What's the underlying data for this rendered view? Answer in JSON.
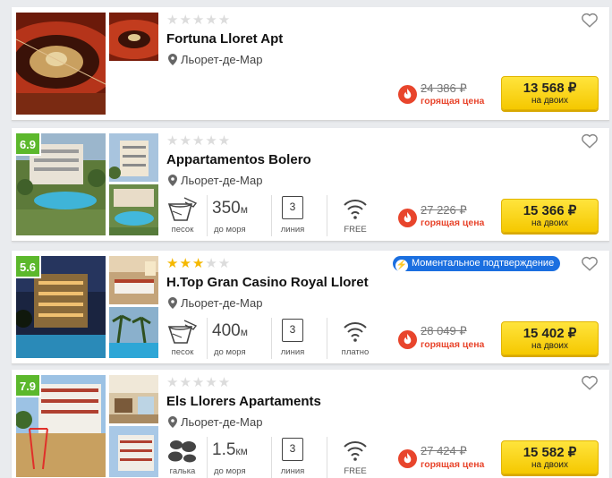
{
  "colors": {
    "rating_bg": "#5cb82c",
    "star_on": "#f5b800",
    "price_button": "#f5c800",
    "hot": "#e8452c",
    "instant_badge": "#1b6fe0"
  },
  "hotels": [
    {
      "name": "Fortuna Lloret Apt",
      "location": "Льорет-де-Мар",
      "stars": 0,
      "rating": "",
      "old_price": "24 386 ₽",
      "hot_label": "горящая цена",
      "price": "13 568 ₽",
      "price_sub": "на двоих",
      "amenities": null
    },
    {
      "name": "Appartamentos Bolero",
      "location": "Льорет-де-Мар",
      "stars": 0,
      "rating": "6.9",
      "old_price": "27 226 ₽",
      "hot_label": "горящая цена",
      "price": "15 366 ₽",
      "price_sub": "на двоих",
      "amenities": {
        "beach_icon": "sand-bucket-icon",
        "beach": "песок",
        "distance_value": "350",
        "distance_unit": "м",
        "distance_label": "до моря",
        "line": "3",
        "line_label": "линия",
        "wifi_icon": "wifi-icon",
        "wifi": "FREE"
      }
    },
    {
      "name": "H.Top Gran Casino Royal Lloret",
      "location": "Льорет-де-Мар",
      "stars": 3,
      "rating": "5.6",
      "instant_badge": "Моментальное подтверждение",
      "old_price": "28 049 ₽",
      "hot_label": "горящая цена",
      "price": "15 402 ₽",
      "price_sub": "на двоих",
      "amenities": {
        "beach_icon": "sand-bucket-icon",
        "beach": "песок",
        "distance_value": "400",
        "distance_unit": "м",
        "distance_label": "до моря",
        "line": "3",
        "line_label": "линия",
        "wifi_icon": "wifi-icon",
        "wifi": "платно"
      }
    },
    {
      "name": "Els Llorers Apartaments",
      "location": "Льорет-де-Мар",
      "stars": 0,
      "rating": "7.9",
      "old_price": "27 424 ₽",
      "hot_label": "горящая цена",
      "price": "15 582 ₽",
      "price_sub": "на двоих",
      "amenities": {
        "beach_icon": "pebbles-icon",
        "beach": "галька",
        "distance_value": "1.5",
        "distance_unit": "км",
        "distance_label": "до моря",
        "line": "3",
        "line_label": "линия",
        "wifi_icon": "wifi-icon",
        "wifi": "FREE"
      }
    }
  ]
}
